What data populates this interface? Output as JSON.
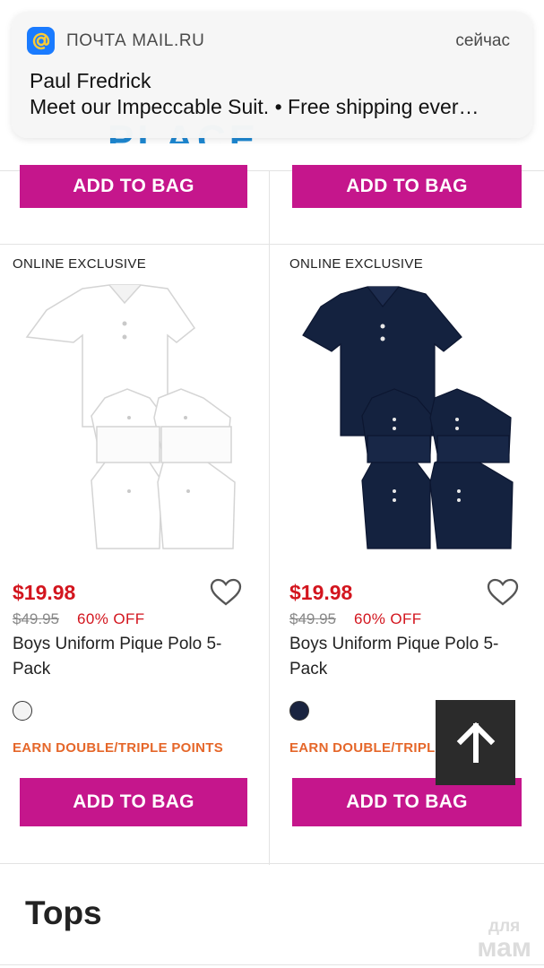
{
  "notification": {
    "app_name": "ПОЧТА MAIL.RU",
    "time": "сейчас",
    "title": "Paul Fredrick",
    "body": "Meet our Impeccable Suit. • Free shipping ever…",
    "app_icon": "at-sign-icon"
  },
  "top_row": {
    "left_button": "ADD TO BAG",
    "right_button": "ADD TO BAG"
  },
  "products": [
    {
      "badge": "ONLINE EXCLUSIVE",
      "image_icon": "white-polo-5-pack-image",
      "price": "$19.98",
      "was_price": "$49.95",
      "discount": "60% OFF",
      "name": "Boys Uniform Pique Polo 5-Pack",
      "swatch_color": "#f4f4f4",
      "promo": "EARN DOUBLE/TRIPLE POINTS",
      "button": "ADD TO BAG"
    },
    {
      "badge": "ONLINE EXCLUSIVE",
      "image_icon": "navy-polo-5-pack-image",
      "price": "$19.98",
      "was_price": "$49.95",
      "discount": "60% OFF",
      "name": "Boys Uniform Pique Polo 5-Pack",
      "swatch_color": "#1a2440",
      "promo": "EARN DOUBLE/TRIPLE POINTS",
      "button": "ADD TO BAG"
    }
  ],
  "section_title": "Tops",
  "watermark": {
    "line1": "для",
    "line2": "мам"
  },
  "colors": {
    "accent": "#c5168c",
    "price_red": "#d3151e",
    "promo_orange": "#e5672a",
    "white_polo": "#ffffff",
    "navy_polo": "#13213f"
  }
}
